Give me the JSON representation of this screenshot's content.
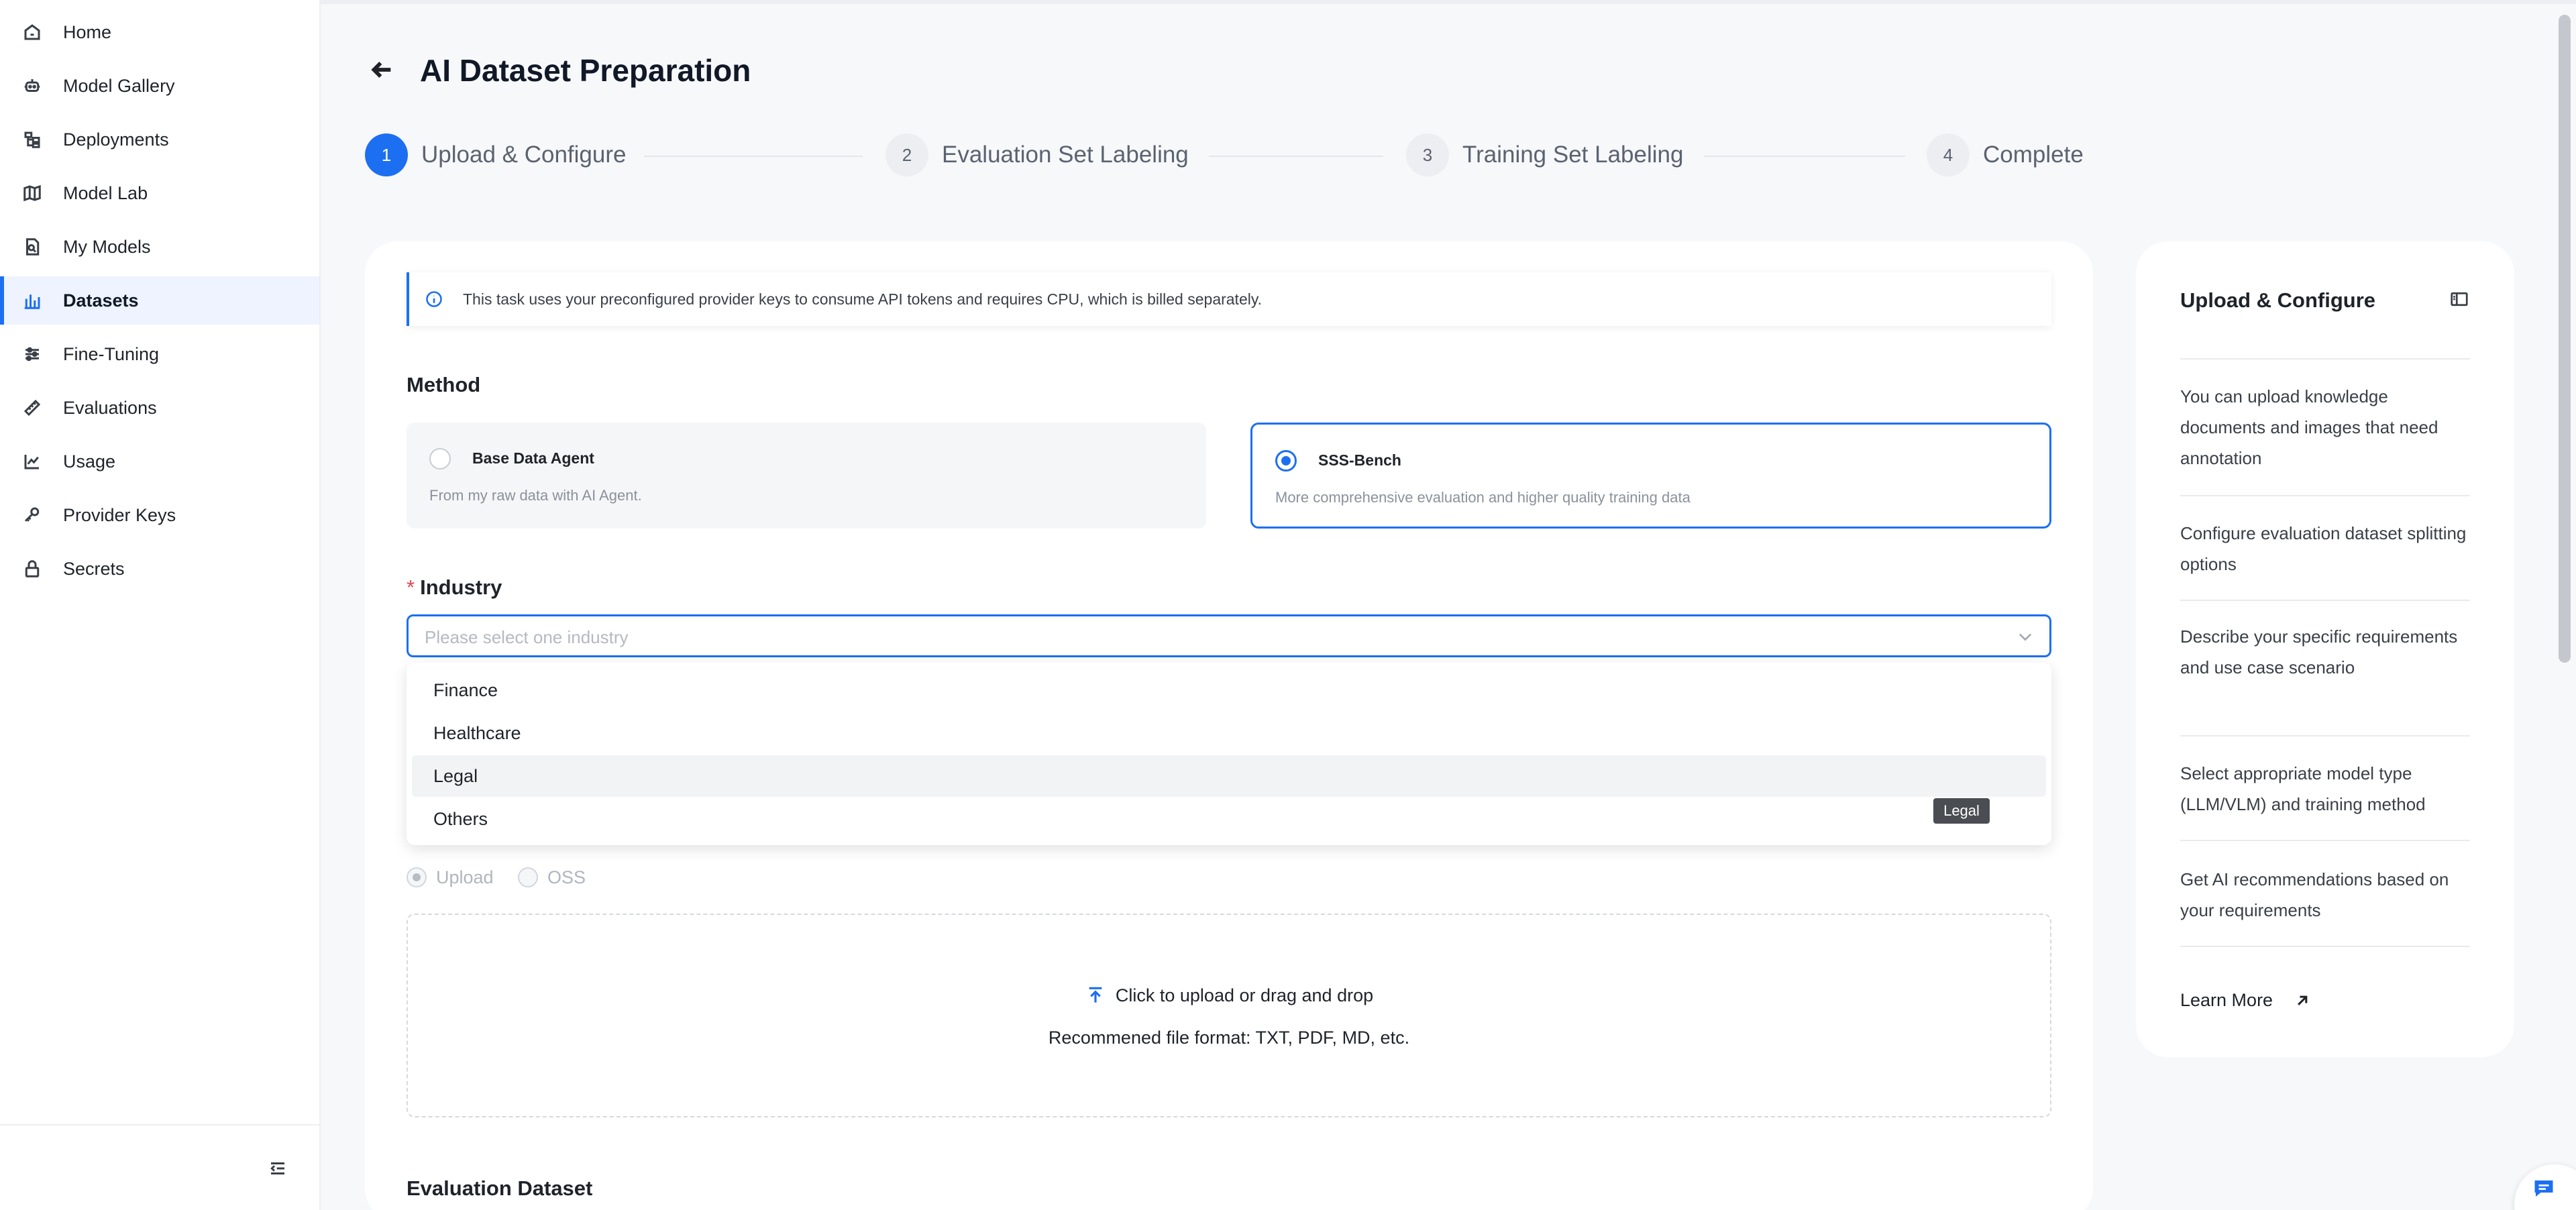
{
  "sidebar": {
    "items": [
      {
        "label": "Home",
        "icon": "home-icon"
      },
      {
        "label": "Model Gallery",
        "icon": "robot-icon"
      },
      {
        "label": "Deployments",
        "icon": "deploy-icon"
      },
      {
        "label": "Model Lab",
        "icon": "map-icon"
      },
      {
        "label": "My Models",
        "icon": "model-icon"
      },
      {
        "label": "Datasets",
        "icon": "bar-chart-icon",
        "active": true
      },
      {
        "label": "Fine-Tuning",
        "icon": "sliders-icon"
      },
      {
        "label": "Evaluations",
        "icon": "ruler-icon"
      },
      {
        "label": "Usage",
        "icon": "line-chart-icon"
      },
      {
        "label": "Provider Keys",
        "icon": "key-icon"
      },
      {
        "label": "Secrets",
        "icon": "lock-icon"
      }
    ]
  },
  "header": {
    "title": "AI Dataset Preparation"
  },
  "steps": [
    {
      "number": "1",
      "label": "Upload & Configure",
      "active": true
    },
    {
      "number": "2",
      "label": "Evaluation Set Labeling"
    },
    {
      "number": "3",
      "label": "Training Set Labeling"
    },
    {
      "number": "4",
      "label": "Complete"
    }
  ],
  "form": {
    "banner": "This task uses your preconfigured provider keys to consume API tokens and requires CPU, which is billed separately.",
    "method_label": "Method",
    "methods": [
      {
        "title": "Base Data Agent",
        "desc": "From my raw data with AI Agent.",
        "selected": false
      },
      {
        "title": "SSS-Bench",
        "desc": "More comprehensive evaluation and higher quality training data",
        "selected": true
      }
    ],
    "industry_required": "*",
    "industry_label": "Industry",
    "industry_placeholder": "Please select one industry",
    "industry_options": [
      "Finance",
      "Healthcare",
      "Legal",
      "Others"
    ],
    "hovered_option": "Legal",
    "tooltip": "Legal",
    "source_options": [
      {
        "label": "Upload",
        "checked": true
      },
      {
        "label": "OSS",
        "checked": false
      }
    ],
    "upload_text": "Click to upload or drag and drop",
    "upload_hint": "Recommened file format: TXT, PDF, MD, etc.",
    "evaluation_dataset_label": "Evaluation Dataset"
  },
  "guide": {
    "title": "Upload & Configure",
    "items": [
      "You can upload knowledge documents and images that need annotation",
      "Configure evaluation dataset splitting options",
      "Describe your specific requirements and use case scenario",
      "Select appropriate model type (LLM/VLM) and training method",
      "Get AI recommendations based on your requirements"
    ],
    "learn_more": "Learn More"
  },
  "colors": {
    "accent": "#1d6ff2",
    "active_nav_bg": "#eef3ff",
    "page_bg": "#f7f8fa"
  }
}
